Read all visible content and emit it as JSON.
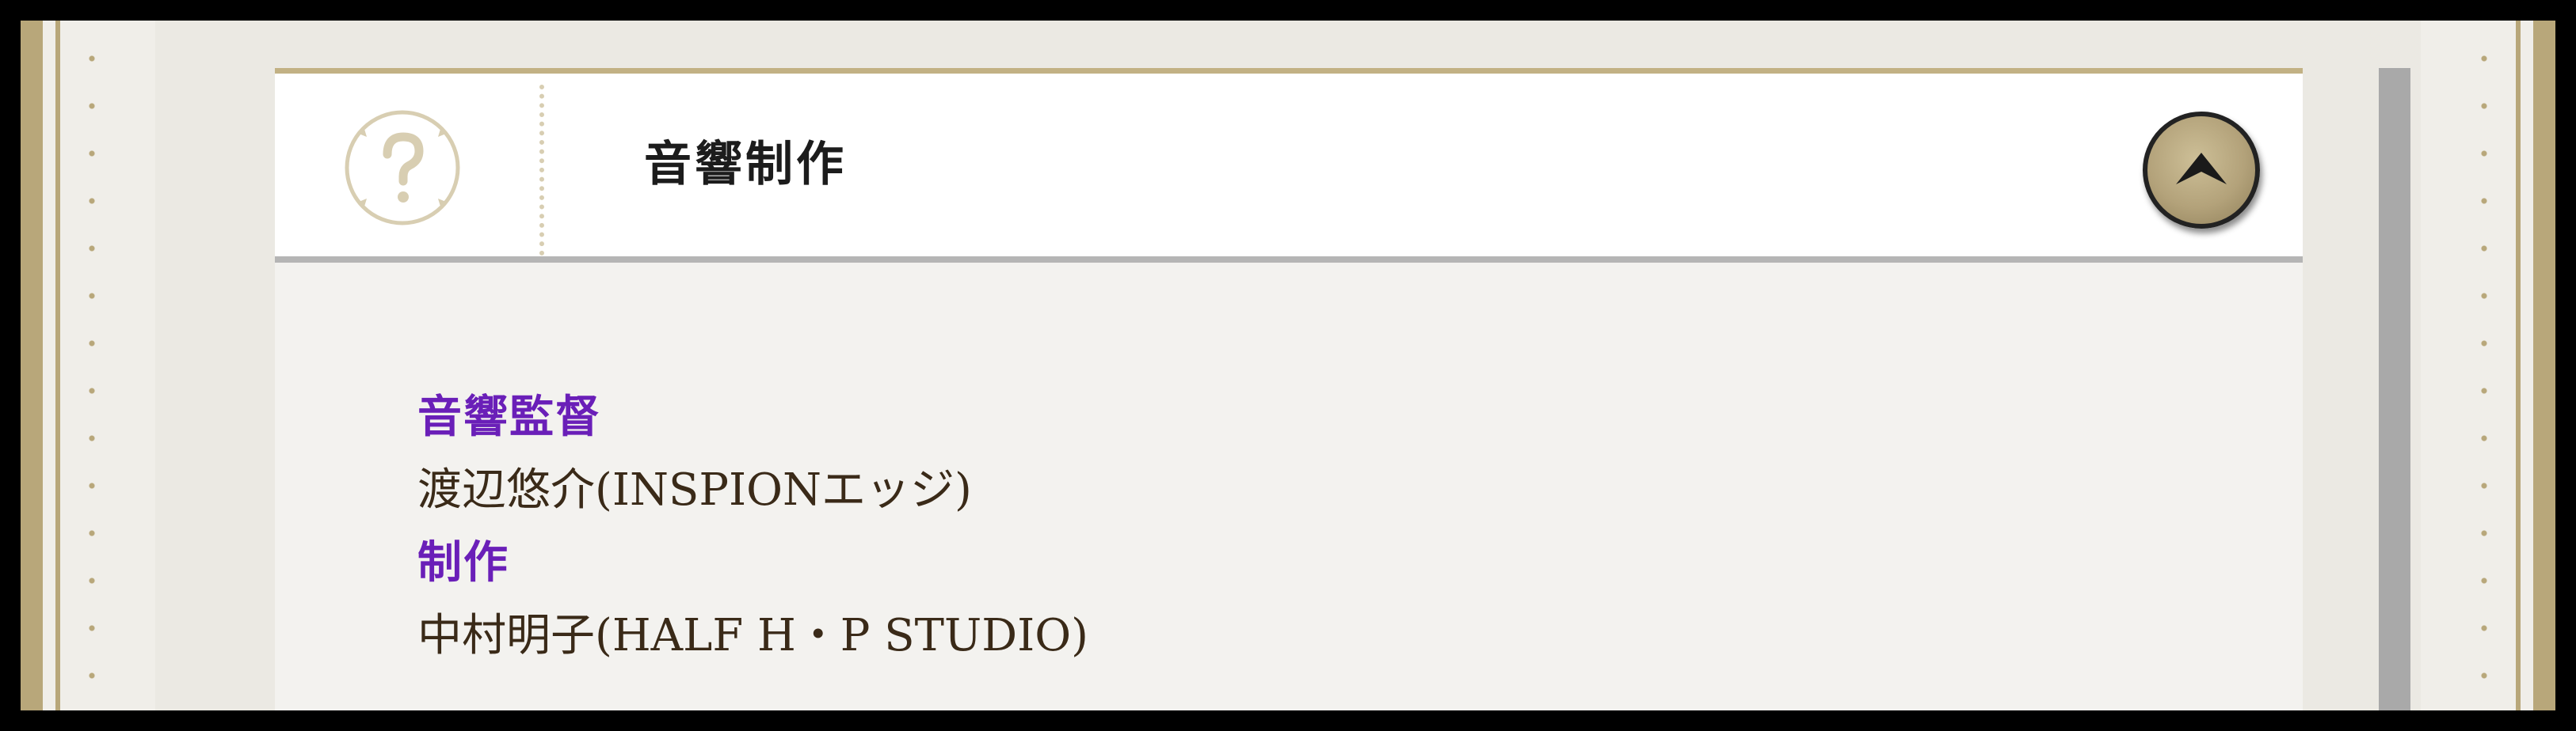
{
  "section": {
    "title": "音響制作",
    "help_icon": "question-circle-icon",
    "toggle_icon": "chevron-up-icon"
  },
  "credits": [
    {
      "role": "音響監督",
      "name": "渡辺悠介(INSPIONエッジ)"
    },
    {
      "role": "制作",
      "name": "中村明子(HALF H・P STUDIO)"
    }
  ],
  "colors": {
    "accent_gold": "#b8a77a",
    "role_purple": "#6a1fb8",
    "name_brown": "#3a2a18"
  }
}
